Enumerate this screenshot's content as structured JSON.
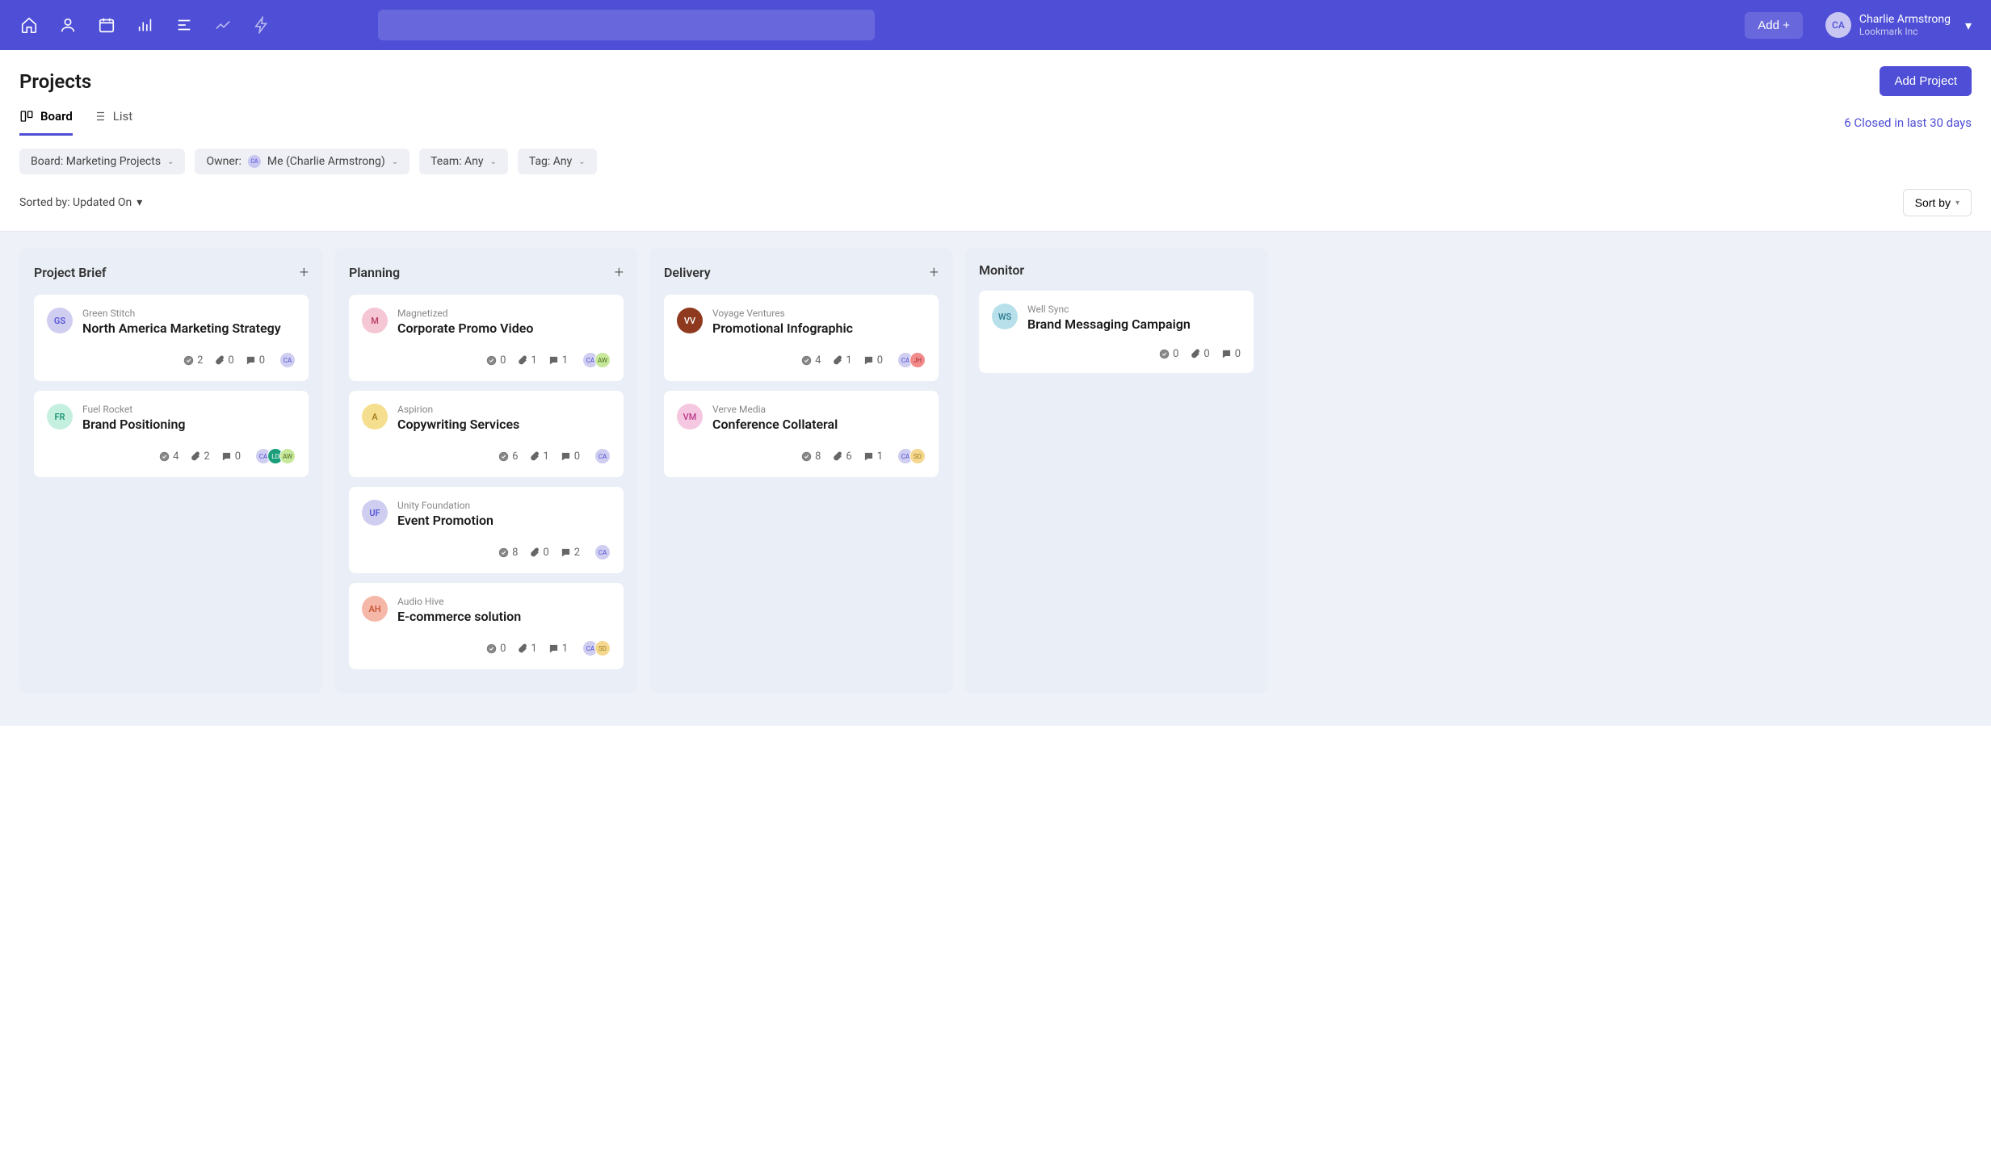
{
  "header": {
    "add_btn": "Add +",
    "user_initials": "CA",
    "user_name": "Charlie Armstrong",
    "user_org": "Lookmark Inc"
  },
  "page": {
    "title": "Projects",
    "add_project": "Add Project",
    "closed_msg": "6 Closed in last 30 days"
  },
  "tabs": {
    "board": "Board",
    "list": "List"
  },
  "filters": {
    "board": "Board: Marketing Projects",
    "owner_label": "Owner:",
    "owner_value": "Me (Charlie Armstrong)",
    "owner_initials": "CA",
    "team": "Team: Any",
    "tag": "Tag: Any"
  },
  "sort": {
    "sorted_by": "Sorted by: Updated On",
    "sort_by": "Sort by"
  },
  "columns": [
    {
      "title": "Project Brief",
      "has_add": true,
      "cards": [
        {
          "client": "Green Stitch",
          "title": "North America Marketing Strategy",
          "avatar": "GS",
          "avatar_bg": "#cfcdf0",
          "avatar_fg": "#4e4ed6",
          "checks": 2,
          "attachments": 0,
          "comments": 0,
          "assignees": [
            {
              "i": "CA",
              "bg": "#cfcdf0",
              "fg": "#4e4ed6"
            }
          ]
        },
        {
          "client": "Fuel Rocket",
          "title": "Brand Positioning",
          "avatar": "FR",
          "avatar_bg": "#c5f0e0",
          "avatar_fg": "#0e8f6a",
          "checks": 4,
          "attachments": 2,
          "comments": 0,
          "assignees": [
            {
              "i": "CA",
              "bg": "#cfcdf0",
              "fg": "#4e4ed6"
            },
            {
              "i": "LD",
              "bg": "#1a9e7a",
              "fg": "#fff"
            },
            {
              "i": "AW",
              "bg": "#c7e89a",
              "fg": "#4a6b1f"
            }
          ]
        }
      ]
    },
    {
      "title": "Planning",
      "has_add": true,
      "cards": [
        {
          "client": "Magnetized",
          "title": "Corporate Promo Video",
          "avatar": "M",
          "avatar_bg": "#f5c7d4",
          "avatar_fg": "#b93a5e",
          "checks": 0,
          "attachments": 1,
          "comments": 1,
          "assignees": [
            {
              "i": "CA",
              "bg": "#cfcdf0",
              "fg": "#4e4ed6"
            },
            {
              "i": "AW",
              "bg": "#c7e89a",
              "fg": "#4a6b1f"
            }
          ]
        },
        {
          "client": "Aspirion",
          "title": "Copywriting Services",
          "avatar": "A",
          "avatar_bg": "#f5df8f",
          "avatar_fg": "#9c7a1a",
          "checks": 6,
          "attachments": 1,
          "comments": 0,
          "assignees": [
            {
              "i": "CA",
              "bg": "#cfcdf0",
              "fg": "#4e4ed6"
            }
          ]
        },
        {
          "client": "Unity Foundation",
          "title": "Event Promotion",
          "avatar": "UF",
          "avatar_bg": "#cfcdf0",
          "avatar_fg": "#4e4ed6",
          "checks": 8,
          "attachments": 0,
          "comments": 2,
          "assignees": [
            {
              "i": "CA",
              "bg": "#cfcdf0",
              "fg": "#4e4ed6"
            }
          ]
        },
        {
          "client": "Audio Hive",
          "title": "E-commerce solution",
          "avatar": "AH",
          "avatar_bg": "#f5b8a8",
          "avatar_fg": "#c44f2e",
          "checks": 0,
          "attachments": 1,
          "comments": 1,
          "assignees": [
            {
              "i": "CA",
              "bg": "#cfcdf0",
              "fg": "#4e4ed6"
            },
            {
              "i": "SD",
              "bg": "#f5d88f",
              "fg": "#9c7a1a"
            }
          ]
        }
      ]
    },
    {
      "title": "Delivery",
      "has_add": true,
      "cards": [
        {
          "client": "Voyage Ventures",
          "title": "Promotional Infographic",
          "avatar": "VV",
          "avatar_bg": "#8f3a1f",
          "avatar_fg": "#fff",
          "checks": 4,
          "attachments": 1,
          "comments": 0,
          "assignees": [
            {
              "i": "CA",
              "bg": "#cfcdf0",
              "fg": "#4e4ed6"
            },
            {
              "i": "JH",
              "bg": "#f28b8b",
              "fg": "#a82b2b"
            }
          ]
        },
        {
          "client": "Verve Media",
          "title": "Conference Collateral",
          "avatar": "VM",
          "avatar_bg": "#f5c7e0",
          "avatar_fg": "#b93a8a",
          "checks": 8,
          "attachments": 6,
          "comments": 1,
          "assignees": [
            {
              "i": "CA",
              "bg": "#cfcdf0",
              "fg": "#4e4ed6"
            },
            {
              "i": "SD",
              "bg": "#f5d88f",
              "fg": "#9c7a1a"
            }
          ]
        }
      ]
    },
    {
      "title": "Monitor",
      "has_add": false,
      "cards": [
        {
          "client": "Well Sync",
          "title": "Brand Messaging Campaign",
          "avatar": "WS",
          "avatar_bg": "#b8e0ea",
          "avatar_fg": "#2b7a8f",
          "checks": 0,
          "attachments": 0,
          "comments": 0,
          "assignees": []
        }
      ]
    }
  ]
}
